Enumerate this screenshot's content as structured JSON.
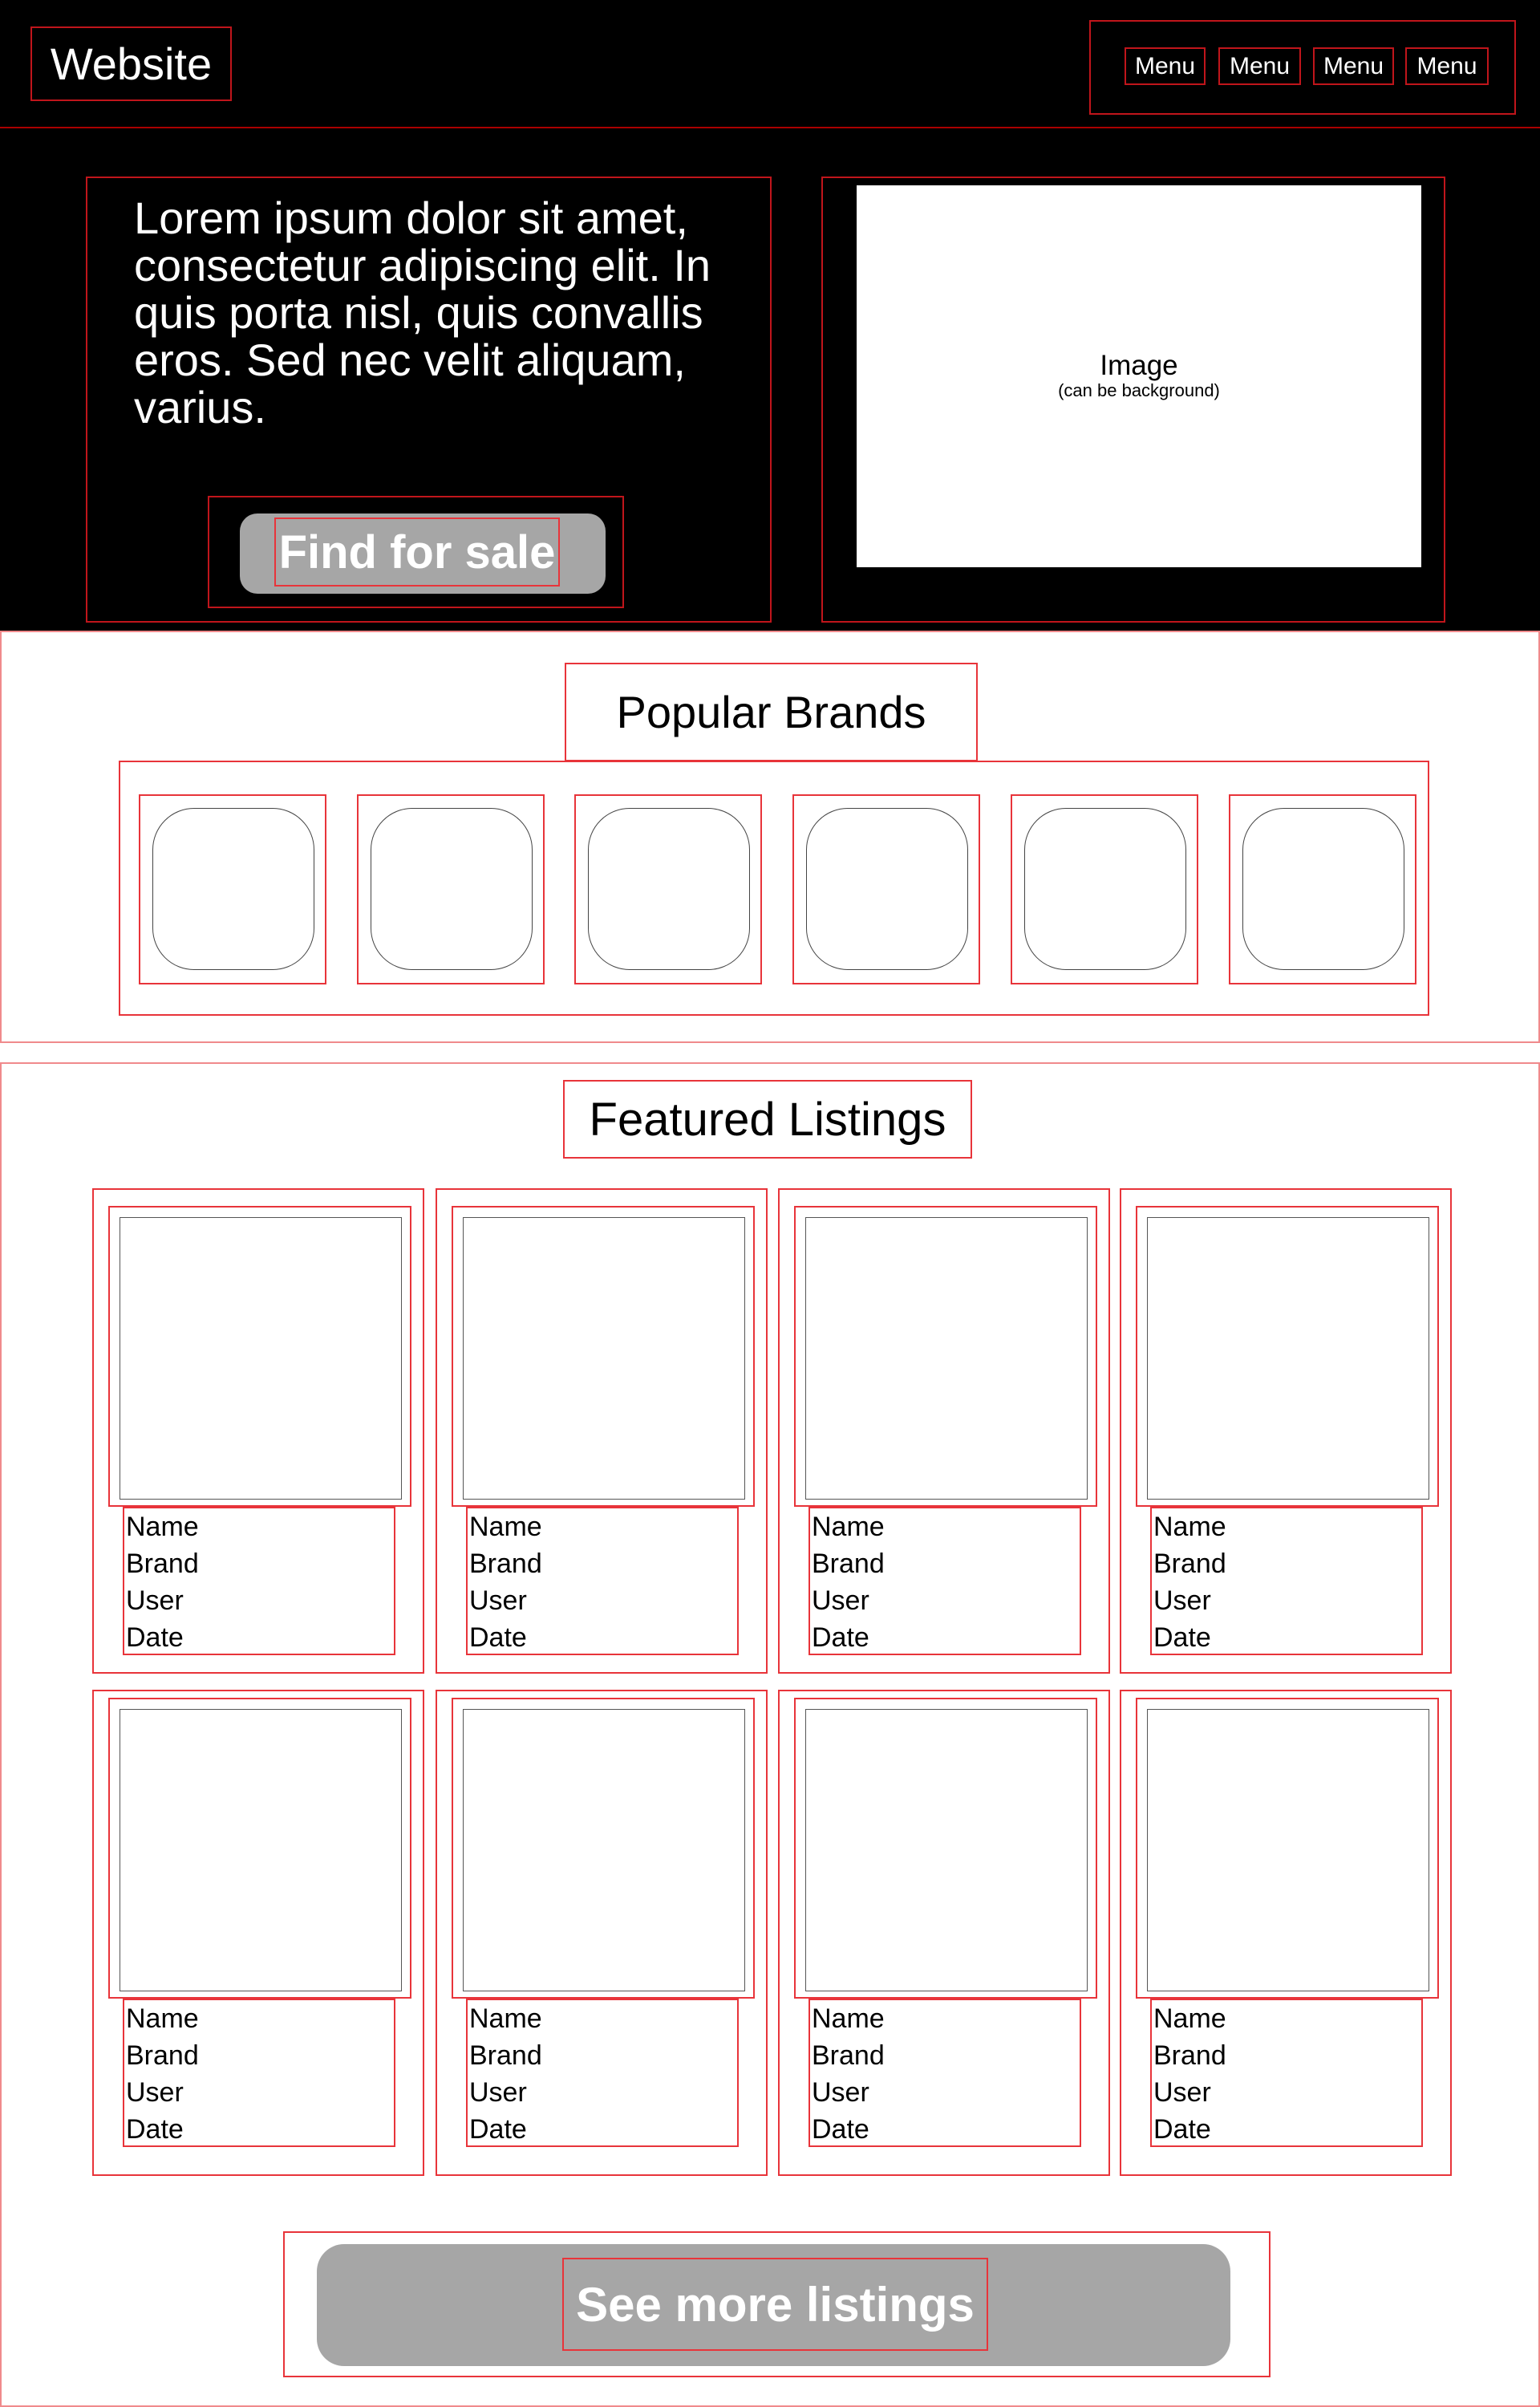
{
  "header": {
    "logo": "Website",
    "menu": [
      "Menu",
      "Menu",
      "Menu",
      "Menu"
    ]
  },
  "hero": {
    "text": "Lorem ipsum dolor sit amet, consectetur adipiscing elit. In quis porta nisl, quis convallis eros. Sed nec velit aliquam, varius.",
    "cta_label": "Find for sale",
    "image_title": "Image",
    "image_subtitle": "(can be background)"
  },
  "brands": {
    "title": "Popular Brands"
  },
  "listings": {
    "title": "Featured Listings",
    "cards": [
      {
        "name": "Name",
        "brand": "Brand",
        "user": "User",
        "date": "Date"
      },
      {
        "name": "Name",
        "brand": "Brand",
        "user": "User",
        "date": "Date"
      },
      {
        "name": "Name",
        "brand": "Brand",
        "user": "User",
        "date": "Date"
      },
      {
        "name": "Name",
        "brand": "Brand",
        "user": "User",
        "date": "Date"
      },
      {
        "name": "Name",
        "brand": "Brand",
        "user": "User",
        "date": "Date"
      },
      {
        "name": "Name",
        "brand": "Brand",
        "user": "User",
        "date": "Date"
      },
      {
        "name": "Name",
        "brand": "Brand",
        "user": "User",
        "date": "Date"
      },
      {
        "name": "Name",
        "brand": "Brand",
        "user": "User",
        "date": "Date"
      }
    ],
    "more_label": "See more listings"
  },
  "colors": {
    "header_bg": "#000000",
    "outline": "#e8343a",
    "button_bg": "#a6a6a6",
    "button_text": "#ffffff"
  }
}
